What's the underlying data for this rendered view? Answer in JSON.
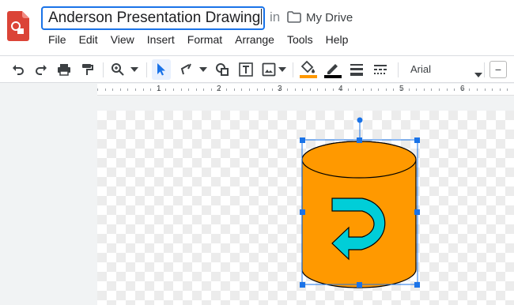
{
  "header": {
    "document_title": "Anderson Presentation Drawing",
    "in_label": "in",
    "drive_label": "My Drive",
    "menu": [
      "File",
      "Edit",
      "View",
      "Insert",
      "Format",
      "Arrange",
      "Tools",
      "Help"
    ]
  },
  "toolbar": {
    "font_name": "Arial",
    "font_size_decrease": "−",
    "tools": [
      "undo-icon",
      "redo-icon",
      "print-icon",
      "paint-format-icon",
      "zoom-icon",
      "select-icon",
      "line-icon",
      "shape-icon",
      "text-box-icon",
      "image-icon",
      "fill-color-icon",
      "border-color-icon",
      "border-weight-icon",
      "border-dash-icon"
    ],
    "fill_color": "#ff9900",
    "border_color": "#000000"
  },
  "ruler": {
    "labels": [
      "1",
      "2",
      "3",
      "4",
      "5",
      "6"
    ]
  },
  "canvas": {
    "shape": "cylinder",
    "shape_fill": "#ff9900",
    "arrow_fill": "#00ced8",
    "selection_color": "#1a73e8"
  }
}
